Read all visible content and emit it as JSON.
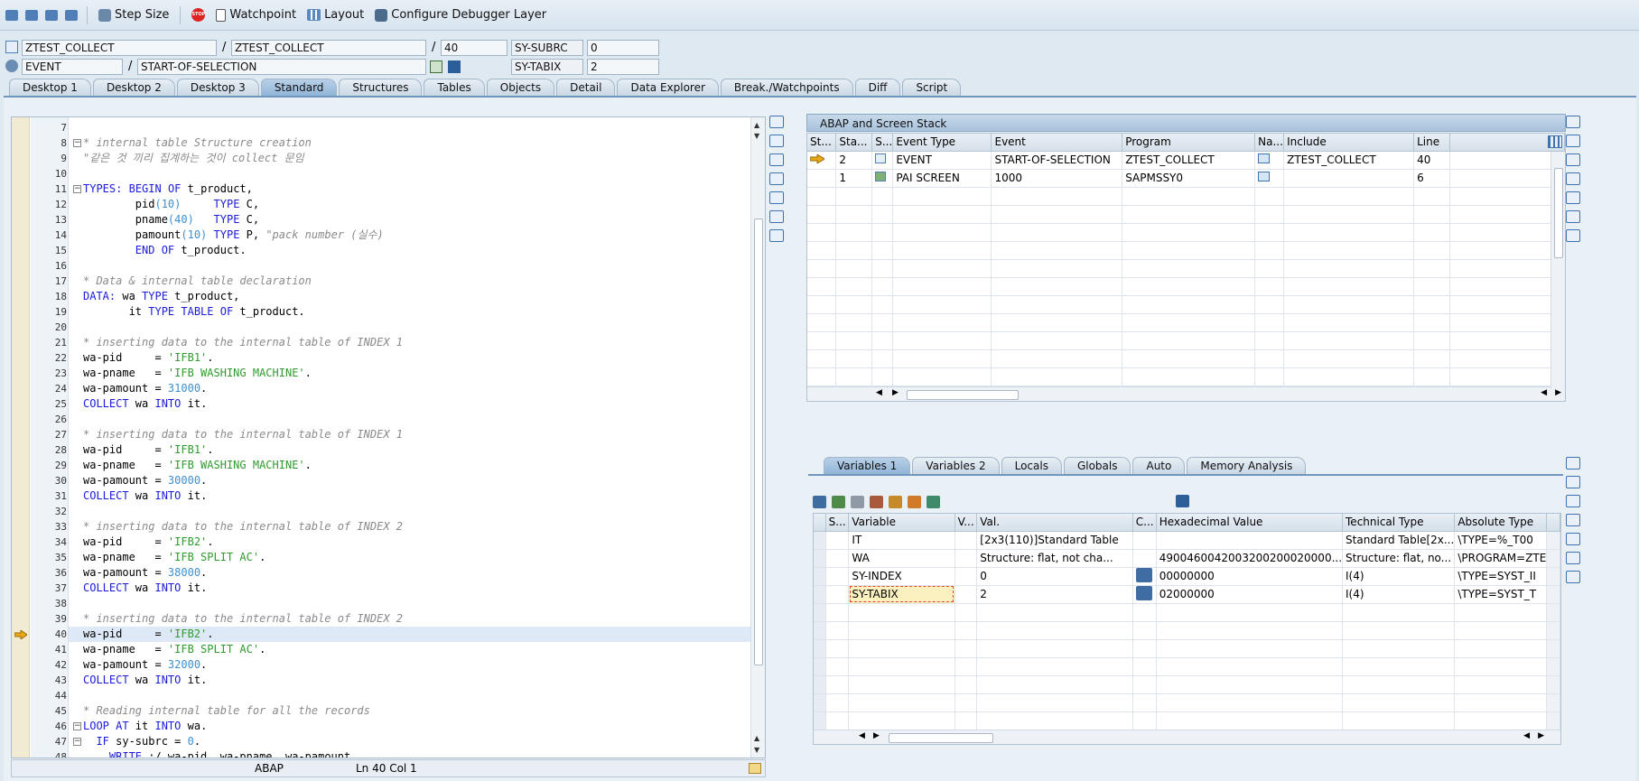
{
  "toolbar": {
    "step_size": "Step Size",
    "watchpoint": "Watchpoint",
    "layout": "Layout",
    "configure": "Configure Debugger Layer"
  },
  "info": {
    "program1": "ZTEST_COLLECT",
    "program2": "ZTEST_COLLECT",
    "line": "40",
    "subrc_label": "SY-SUBRC",
    "subrc_value": "0",
    "event_type": "EVENT",
    "event_name": "START-OF-SELECTION",
    "tabix_label": "SY-TABIX",
    "tabix_value": "2"
  },
  "tabs": [
    "Desktop 1",
    "Desktop 2",
    "Desktop 3",
    "Standard",
    "Structures",
    "Tables",
    "Objects",
    "Detail",
    "Data Explorer",
    "Break./Watchpoints",
    "Diff",
    "Script"
  ],
  "active_tab": "Standard",
  "editor": {
    "lines": [
      {
        "n": "7",
        "html": ""
      },
      {
        "n": "8",
        "html": "<span class=\"cm\">* internal table Structure creation</span>"
      },
      {
        "n": "9",
        "html": "<span class=\"cm\">\"같은 것 끼리 집계하는 것이 collect 문임</span>"
      },
      {
        "n": "10",
        "html": ""
      },
      {
        "n": "11",
        "html": "<span class=\"kw\">TYPES:</span> <span class=\"kw\">BEGIN OF</span> t_product,"
      },
      {
        "n": "12",
        "html": "        pid<span class=\"nm\">(10)</span>     <span class=\"kw\">TYPE</span> C,"
      },
      {
        "n": "13",
        "html": "        pname<span class=\"nm\">(40)</span>   <span class=\"kw\">TYPE</span> C,"
      },
      {
        "n": "14",
        "html": "        pamount<span class=\"nm\">(10)</span> <span class=\"kw\">TYPE</span> P, <span class=\"cm\">\"pack number (실수)</span>"
      },
      {
        "n": "15",
        "html": "        <span class=\"kw\">END OF</span> t_product."
      },
      {
        "n": "16",
        "html": ""
      },
      {
        "n": "17",
        "html": "<span class=\"cm\">* Data &amp; internal table declaration</span>"
      },
      {
        "n": "18",
        "html": "<span class=\"kw\">DATA:</span> wa <span class=\"kw\">TYPE</span> t_product,"
      },
      {
        "n": "19",
        "html": "       it <span class=\"kw\">TYPE TABLE OF</span> t_product."
      },
      {
        "n": "20",
        "html": ""
      },
      {
        "n": "21",
        "html": "<span class=\"cm\">* inserting data to the internal table of INDEX 1</span>"
      },
      {
        "n": "22",
        "html": "wa-pid     = <span class=\"st\">'IFB1'</span>."
      },
      {
        "n": "23",
        "html": "wa-pname   = <span class=\"st\">'IFB WASHING MACHINE'</span>."
      },
      {
        "n": "24",
        "html": "wa-pamount = <span class=\"nm\">31000</span>."
      },
      {
        "n": "25",
        "html": "<span class=\"kw\">COLLECT</span> wa <span class=\"kw\">INTO</span> it."
      },
      {
        "n": "26",
        "html": ""
      },
      {
        "n": "27",
        "html": "<span class=\"cm\">* inserting data to the internal table of INDEX 1</span>"
      },
      {
        "n": "28",
        "html": "wa-pid     = <span class=\"st\">'IFB1'</span>."
      },
      {
        "n": "29",
        "html": "wa-pname   = <span class=\"st\">'IFB WASHING MACHINE'</span>."
      },
      {
        "n": "30",
        "html": "wa-pamount = <span class=\"nm\">30000</span>."
      },
      {
        "n": "31",
        "html": "<span class=\"kw\">COLLECT</span> wa <span class=\"kw\">INTO</span> it."
      },
      {
        "n": "32",
        "html": ""
      },
      {
        "n": "33",
        "html": "<span class=\"cm\">* inserting data to the internal table of INDEX 2</span>"
      },
      {
        "n": "34",
        "html": "wa-pid     = <span class=\"st\">'IFB2'</span>."
      },
      {
        "n": "35",
        "html": "wa-pname   = <span class=\"st\">'IFB SPLIT AC'</span>."
      },
      {
        "n": "36",
        "html": "wa-pamount = <span class=\"nm\">38000</span>."
      },
      {
        "n": "37",
        "html": "<span class=\"kw\">COLLECT</span> wa <span class=\"kw\">INTO</span> it."
      },
      {
        "n": "38",
        "html": ""
      },
      {
        "n": "39",
        "html": "<span class=\"cm\">* inserting data to the internal table of INDEX 2</span>"
      },
      {
        "n": "40",
        "html": "wa-pid     = <span class=\"st\">'IFB2'</span>."
      },
      {
        "n": "41",
        "html": "wa-pname   = <span class=\"st\">'IFB SPLIT AC'</span>."
      },
      {
        "n": "42",
        "html": "wa-pamount = <span class=\"nm\">32000</span>."
      },
      {
        "n": "43",
        "html": "<span class=\"kw\">COLLECT</span> wa <span class=\"kw\">INTO</span> it."
      },
      {
        "n": "44",
        "html": ""
      },
      {
        "n": "45",
        "html": "<span class=\"cm\">* Reading internal table for all the records</span>"
      },
      {
        "n": "46",
        "html": "<span class=\"kw\">LOOP AT</span> it <span class=\"kw\">INTO</span> wa."
      },
      {
        "n": "47",
        "html": "  <span class=\"kw\">IF</span> sy-subrc = <span class=\"nm\">0</span>."
      },
      {
        "n": "48",
        "html": "    <span class=\"kw\">WRITE</span> :/ wa-pid, wa-pname, wa-pamount."
      }
    ],
    "current_line": "40"
  },
  "status": {
    "lang": "ABAP",
    "pos": "Ln  40 Col  1"
  },
  "stack": {
    "title": "ABAP and Screen Stack",
    "headers": [
      "St...",
      "Sta...",
      "S...",
      "Event Type",
      "Event",
      "Program",
      "Na...",
      "Include",
      "Line"
    ],
    "rows": [
      {
        "level": "2",
        "event_type": "EVENT",
        "event": "START-OF-SELECTION",
        "program": "ZTEST_COLLECT",
        "include": "ZTEST_COLLECT",
        "line": "40"
      },
      {
        "level": "1",
        "event_type": "PAI SCREEN",
        "event": "1000",
        "program": "SAPMSSY0",
        "include": "",
        "line": "6"
      }
    ]
  },
  "var_tabs": [
    "Variables 1",
    "Variables 2",
    "Locals",
    "Globals",
    "Auto",
    "Memory Analysis"
  ],
  "variables": {
    "headers": [
      "S...",
      "Variable",
      "V...",
      "Val.",
      "C...",
      "Hexadecimal Value",
      "Technical Type",
      "Absolute Type"
    ],
    "rows": [
      {
        "name": "IT",
        "val": "[2x3(110)]Standard Table",
        "hex": "",
        "tech": "Standard Table[2x...",
        "abs": "\\TYPE=%_T00"
      },
      {
        "name": "WA",
        "val": "Structure: flat, not cha...",
        "hex": "4900460042003200200020000...",
        "tech": "Structure: flat, no...",
        "abs": "\\PROGRAM=ZTE"
      },
      {
        "name": "SY-INDEX",
        "val": "0",
        "hex": "00000000",
        "tech": "I(4)",
        "abs": "\\TYPE=SYST_II"
      },
      {
        "name": "SY-TABIX",
        "val": "2",
        "hex": "02000000",
        "tech": "I(4)",
        "abs": "\\TYPE=SYST_T"
      }
    ]
  }
}
